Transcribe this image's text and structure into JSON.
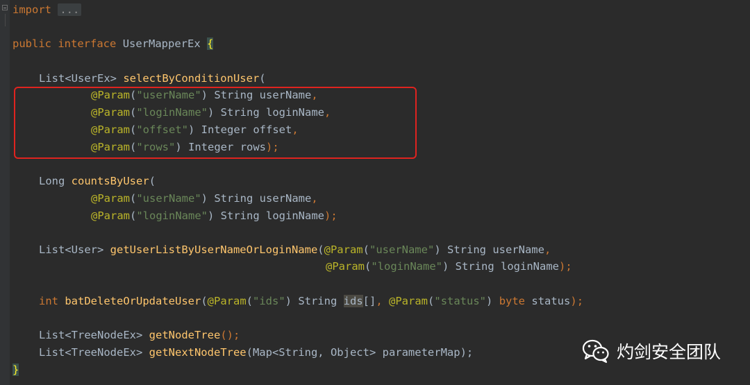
{
  "code": {
    "import_kw": "import",
    "import_collapsed": "...",
    "iface": {
      "public": "public",
      "interface": "interface",
      "name": "UserMapperEx",
      "open": "{"
    },
    "m1": {
      "ret_type": "List",
      "ret_generic": "<UserEx>",
      "name": "selectByConditionUser",
      "open": "(",
      "params": [
        {
          "ann": "@Param",
          "lp": "(",
          "str": "\"userName\"",
          "rp": ")",
          "type": " String ",
          "name": "userName",
          "end": ","
        },
        {
          "ann": "@Param",
          "lp": "(",
          "str": "\"loginName\"",
          "rp": ")",
          "type": " String ",
          "name": "loginName",
          "end": ","
        },
        {
          "ann": "@Param",
          "lp": "(",
          "str": "\"offset\"",
          "rp": ")",
          "type": " Integer ",
          "name": "offset",
          "end": ","
        },
        {
          "ann": "@Param",
          "lp": "(",
          "str": "\"rows\"",
          "rp": ")",
          "type": " Integer ",
          "name": "rows",
          "end": ");"
        }
      ]
    },
    "m2": {
      "ret_type": "Long",
      "name": "countsByUser",
      "open": "(",
      "params": [
        {
          "ann": "@Param",
          "lp": "(",
          "str": "\"userName\"",
          "rp": ")",
          "type": " String ",
          "name": "userName",
          "end": ","
        },
        {
          "ann": "@Param",
          "lp": "(",
          "str": "\"loginName\"",
          "rp": ")",
          "type": " String ",
          "name": "loginName",
          "end": ");"
        }
      ]
    },
    "m3": {
      "ret_type": "List",
      "ret_generic": "<User>",
      "name": "getUserListByUserNameOrLoginName",
      "open": "(",
      "params": [
        {
          "ann": "@Param",
          "lp": "(",
          "str": "\"userName\"",
          "rp": ")",
          "type": " String ",
          "name": "userName",
          "end": ","
        },
        {
          "ann": "@Param",
          "lp": "(",
          "str": "\"loginName\"",
          "rp": ")",
          "type": " String ",
          "name": "loginName",
          "end": ");"
        }
      ]
    },
    "m4": {
      "ret_type": "int",
      "name": "batDeleteOrUpdateUser",
      "open": "(",
      "p1_ann": "@Param",
      "p1_lp": "(",
      "p1_str": "\"ids\"",
      "p1_rp": ")",
      "p1_type": " String ",
      "p1_name": "ids",
      "p1_arr": "[]",
      "p1_end": ", ",
      "p2_ann": "@Param",
      "p2_lp": "(",
      "p2_str": "\"status\"",
      "p2_rp": ")",
      "p2_type": " byte ",
      "p2_name": "status",
      "p2_end": ");"
    },
    "m5": {
      "ret_type": "List",
      "ret_generic": "<TreeNodeEx>",
      "name": "getNodeTree",
      "rest": "();"
    },
    "m6": {
      "ret_type": "List",
      "ret_generic": "<TreeNodeEx>",
      "name": "getNextNodeTree",
      "params": "(Map<String, Object> parameterMap);"
    },
    "close": "}"
  },
  "watermark": {
    "icon": "wechat-icon",
    "text": "灼剑安全团队"
  },
  "colors": {
    "background": "#2b2b2b",
    "highlight_box": "#e0231f"
  }
}
